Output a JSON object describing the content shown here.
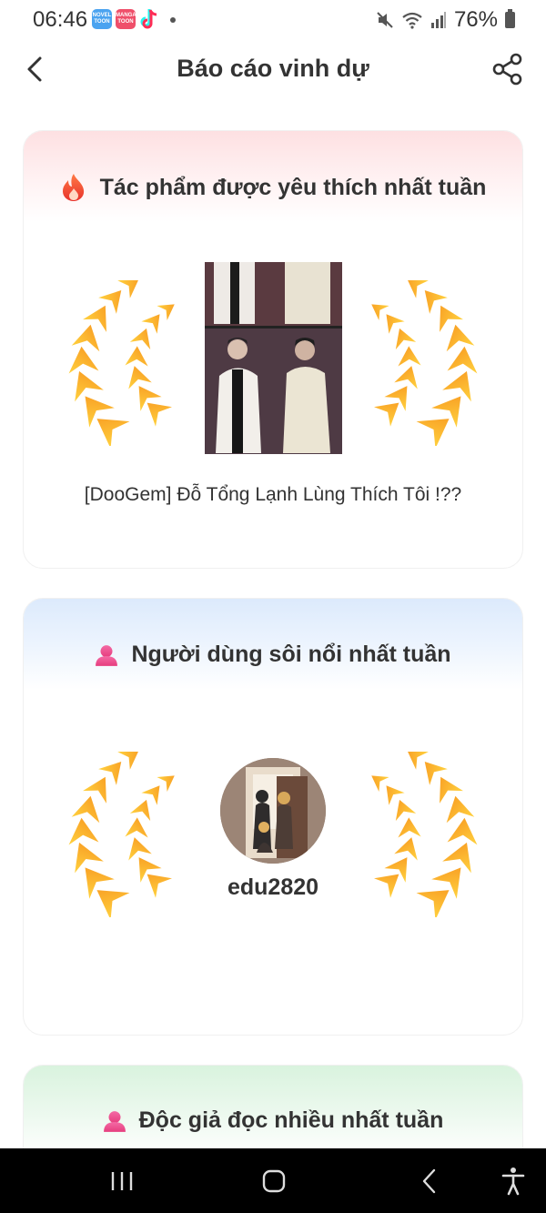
{
  "status_bar": {
    "time": "06:46",
    "apps": [
      {
        "name": "novel-toon",
        "label": "NOVEL TOON"
      },
      {
        "name": "manga-toon",
        "label": "MANGA TOON"
      }
    ],
    "battery": "76%"
  },
  "header": {
    "title": "Báo cáo vinh dự",
    "back_icon": "chevron-left-icon",
    "share_icon": "share-icon"
  },
  "sections": [
    {
      "title": "Tác phẩm được yêu thích nhất tuần",
      "icon": "fire-icon",
      "item_title": "[DooGem] Đỗ Tổng Lạnh Lùng Thích Tôi !??"
    },
    {
      "title": "Người dùng sôi nổi nhất tuần",
      "icon": "user-icon",
      "username": "edu2820"
    },
    {
      "title": "Độc giả đọc nhiều nhất tuần",
      "icon": "user-icon"
    }
  ],
  "colors": {
    "laurel_light": "#ffd23f",
    "laurel_dark": "#f7931e",
    "fire": "#f2452f",
    "user_icon": "#ee4f8f"
  },
  "nav_bar": [
    "recents-icon",
    "home-icon",
    "back-icon",
    "accessibility-icon"
  ]
}
